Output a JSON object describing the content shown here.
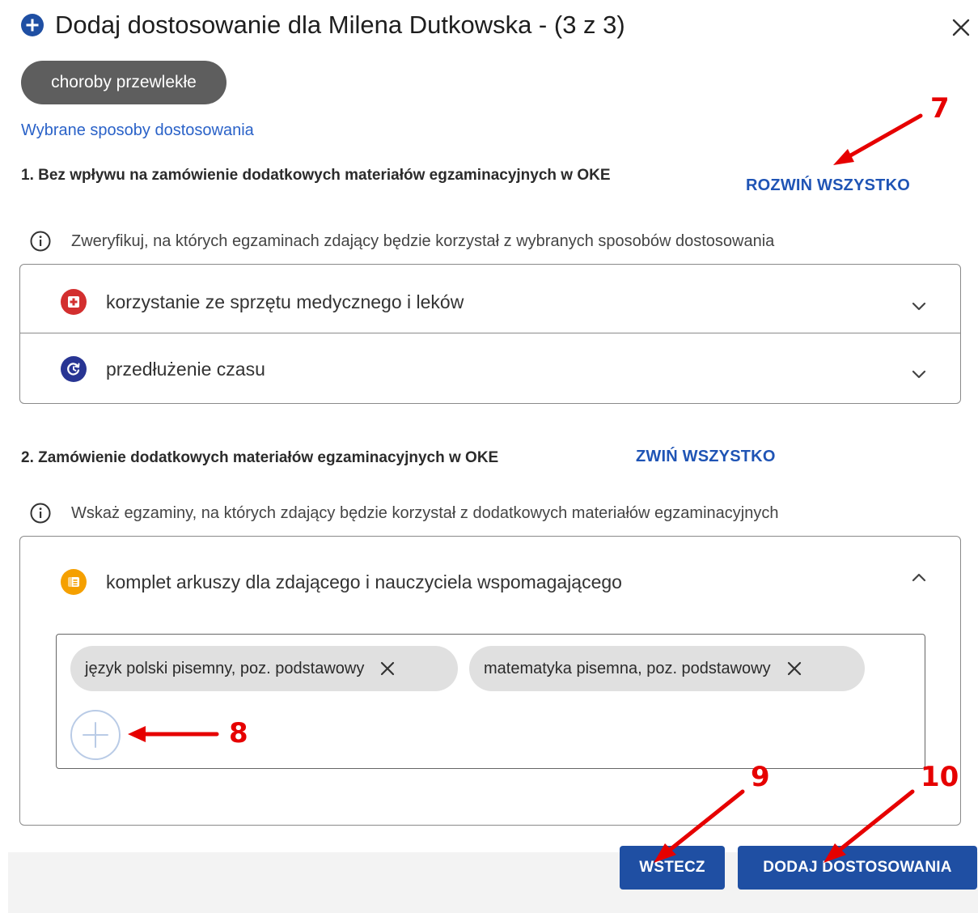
{
  "dialog": {
    "title": "Dodaj dostosowanie dla Milena Dutkowska - (3 z 3)",
    "title_icon": "plus-circle-icon",
    "close_icon": "close-icon",
    "condition_chip": "choroby przewlekłe",
    "selected_methods_label": "Wybrane sposoby dostosowania"
  },
  "section1": {
    "title": "1. Bez wpływu na zamówienie dodatkowych materiałów egzaminacyjnych w OKE",
    "expand_all_label": "ROZWIŃ WSZYSTKO",
    "info_text": "Zweryfikuj, na których egzaminach zdający będzie korzystał z wybranych sposobów dostosowania",
    "items": [
      {
        "label": "korzystanie ze sprzętu medycznego i leków",
        "icon": "medical-cross-icon",
        "color": "#d32f2f"
      },
      {
        "label": "przedłużenie czasu",
        "icon": "clock-refresh-icon",
        "color": "#283593"
      }
    ]
  },
  "section2": {
    "title": "2. Zamówienie dodatkowych materiałów egzaminacyjnych w OKE",
    "collapse_all_label": "ZWIŃ WSZYSTKO",
    "info_text": "Wskaż egzaminy, na których zdający będzie korzystał z dodatkowych materiałów egzaminacyjnych",
    "item": {
      "label": "komplet arkuszy dla zdającego i nauczyciela wspomagającego",
      "icon": "sheets-icon",
      "color": "#f5a000"
    },
    "exams": [
      "język polski pisemny, poz. podstawowy",
      "matematyka pisemna, poz. podstawowy"
    ]
  },
  "footer": {
    "back_label": "WSTECZ",
    "add_label": "DODAJ DOSTOSOWANIA"
  },
  "annotations": [
    "7",
    "8",
    "9",
    "10"
  ],
  "colors": {
    "primary": "#1f4fa3",
    "link": "#2a62c8",
    "annotation": "#e60000"
  }
}
